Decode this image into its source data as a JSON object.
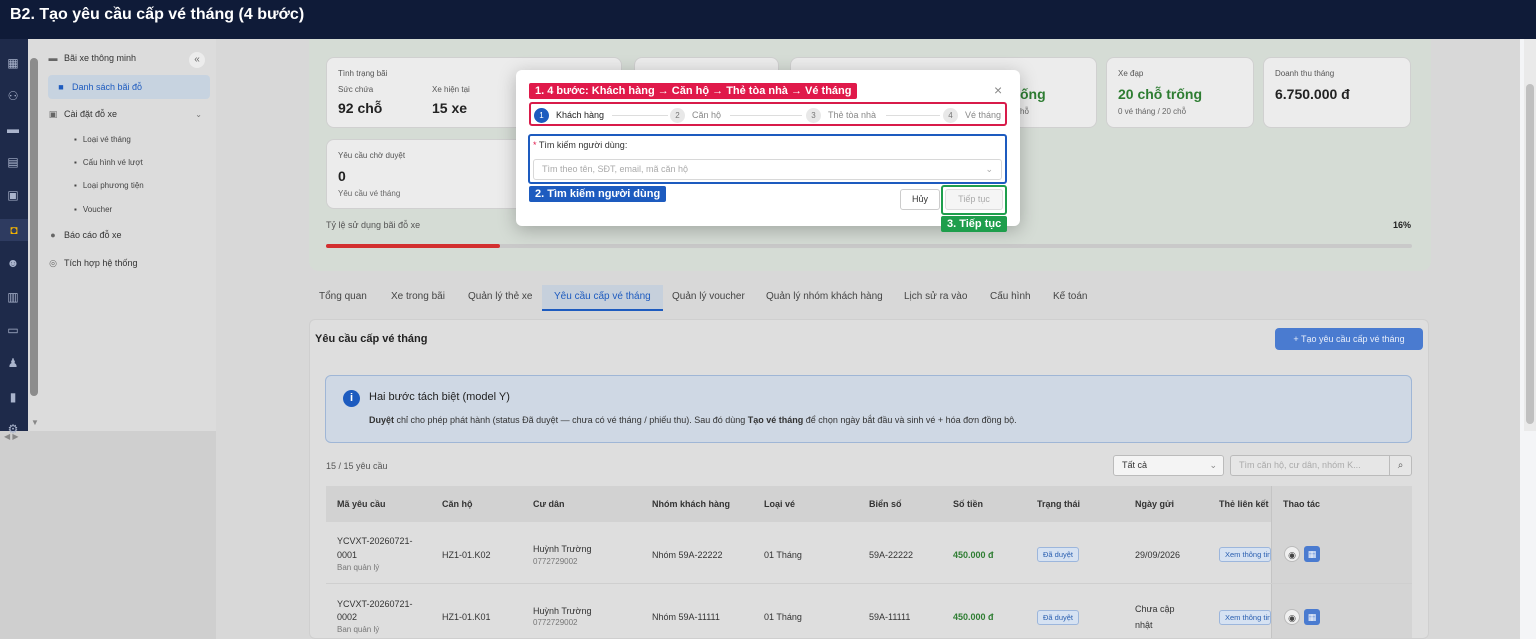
{
  "title": "B2. Tạo yêu cầu cấp vé tháng (4 bước)",
  "sidebar": {
    "brand": "Bãi xe thông minh",
    "items": [
      {
        "label": "Danh sách bãi đỗ"
      },
      {
        "label": "Cài đặt đỗ xe"
      },
      {
        "label": "Báo cáo đỗ xe"
      },
      {
        "label": "Tích hợp hệ thống"
      }
    ],
    "subitems": [
      {
        "label": "Loại vé tháng"
      },
      {
        "label": "Cấu hình vé lượt"
      },
      {
        "label": "Loại phương tiện"
      },
      {
        "label": "Voucher"
      }
    ]
  },
  "stats": {
    "status": {
      "label": "Tình trạng bãi",
      "capacity_label": "Sức chứa",
      "capacity_value": "92 chỗ",
      "current_label": "Xe hiện tại",
      "current_value": "15 xe"
    },
    "partial": {
      "value": "ống",
      "sub": "hỗ"
    },
    "bicycle": {
      "label": "Xe đạp",
      "value": "20 chỗ trống",
      "sub": "0 vé tháng / 20 chỗ"
    },
    "revenue": {
      "label": "Doanh thu tháng",
      "value": "6.750.000 đ"
    },
    "pending": {
      "label": "Yêu cầu chờ duyệt",
      "value": "0",
      "sub": "Yêu cầu vé tháng"
    },
    "usage_label": "Tỷ lệ sử dụng bãi đỗ xe",
    "usage_value": "16%",
    "usage_fraction": 0.16
  },
  "tabs": [
    "Tổng quan",
    "Xe trong bãi",
    "Quản lý thẻ xe",
    "Yêu cầu cấp vé tháng",
    "Quản lý voucher",
    "Quản lý nhóm khách hàng",
    "Lịch sử ra vào",
    "Cấu hình",
    "Kế toán"
  ],
  "panel": {
    "title": "Yêu cầu cấp vé tháng",
    "create_label": "Tạo yêu cầu cấp vé tháng",
    "info_title": "Hai bước tách biệt (model Y)",
    "info_b1": "Duyệt",
    "info_t1": " chỉ cho phép phát hành (status Đã duyệt — chưa có vé tháng / phiếu thu). Sau đó dùng ",
    "info_b2": "Tạo vé tháng",
    "info_t2": " để chọn ngày bắt đầu và sinh vé + hóa đơn đồng bộ.",
    "count": "15 / 15 yêu cầu",
    "filter_value": "Tất cả",
    "search_placeholder": "Tìm căn hộ, cư dân, nhóm K..."
  },
  "table": {
    "headers": [
      "Mã yêu cầu",
      "Căn hộ",
      "Cư dân",
      "Nhóm khách hàng",
      "Loại vé",
      "Biển số",
      "Số tiền",
      "Trạng thái",
      "Ngày gửi",
      "Thẻ liên kết",
      "Thao tác"
    ],
    "rows": [
      {
        "code1": "YCVXT-20260721-",
        "code2": "0001",
        "by": "Ban quản lý",
        "apt": "HZ1-01.K02",
        "name": "Huỳnh Trường",
        "phone": "0772729002",
        "group": "Nhóm 59A-22222",
        "ticket": "01 Tháng",
        "plate": "59A-22222",
        "amount": "450.000 đ",
        "status": "Đã duyệt",
        "date1": "29/09/2026",
        "date2": "",
        "card": "Xem thông tin"
      },
      {
        "code1": "YCVXT-20260721-",
        "code2": "0002",
        "by": "Ban quản lý",
        "apt": "HZ1-01.K01",
        "name": "Huỳnh Trường",
        "phone": "0772729002",
        "group": "Nhóm 59A-11111",
        "ticket": "01 Tháng",
        "plate": "59A-11111",
        "amount": "450.000 đ",
        "status": "Đã duyệt",
        "date1": "Chưa cập",
        "date2": "nhật",
        "card": "Xem thông tin"
      }
    ]
  },
  "modal": {
    "steps": [
      {
        "num": "1",
        "label": "Khách hàng"
      },
      {
        "num": "2",
        "label": "Căn hộ"
      },
      {
        "num": "3",
        "label": "Thẻ tòa nhà"
      },
      {
        "num": "4",
        "label": "Vé tháng"
      }
    ],
    "field_label": "Tìm kiếm người dùng:",
    "field_required": "*",
    "field_placeholder": "Tìm theo tên, SĐT, email, mã căn hộ",
    "cancel_label": "Hủy",
    "next_label": "Tiếp tục",
    "close": "×"
  },
  "annotations": {
    "a1": "1. 4 bước: Khách hàng → Căn hộ → Thẻ tòa nhà → Vé tháng",
    "a2": "2. Tìm kiếm người dùng",
    "a3": "3. Tiếp tục"
  },
  "colors": {
    "accent": "#1d5bbf",
    "annotation_red": "#e0194a",
    "annotation_green": "#1e9e4c",
    "titlebar": "#0f1b38"
  }
}
